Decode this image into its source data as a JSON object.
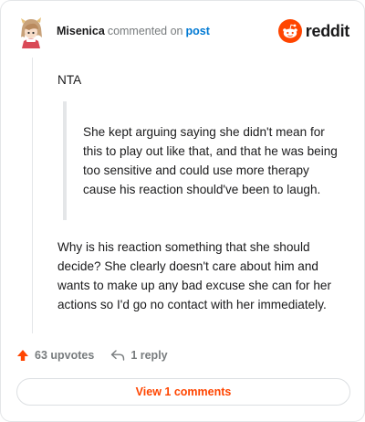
{
  "header": {
    "author": "Misenica",
    "action_text": "commented on",
    "target_text": "post",
    "avatar_icon": "anime-character-avatar"
  },
  "brand": {
    "wordmark": "reddit",
    "icon": "reddit-snoo-icon",
    "color": "#ff4500"
  },
  "comment": {
    "paragraph_1": "NTA",
    "quote": "She kept arguing saying she didn't mean for this to play out like that, and that he was being too sensitive and could use more therapy cause his reaction should've been to laugh.",
    "paragraph_2": "Why is his reaction something that she should decide? She clearly doesn't care about him and wants to make up any bad excuse she can for her actions so I'd go no contact with her immediately."
  },
  "actions": {
    "upvotes_label": "63 upvotes",
    "upvote_icon": "upvote-arrow-icon",
    "reply_label": "1 reply",
    "reply_icon": "reply-arrow-icon"
  },
  "view_comments": {
    "label": "View 1 comments"
  },
  "colors": {
    "accent": "#ff4500",
    "link": "#0079d3",
    "muted": "#787c7e",
    "border": "#e4e6e8"
  }
}
